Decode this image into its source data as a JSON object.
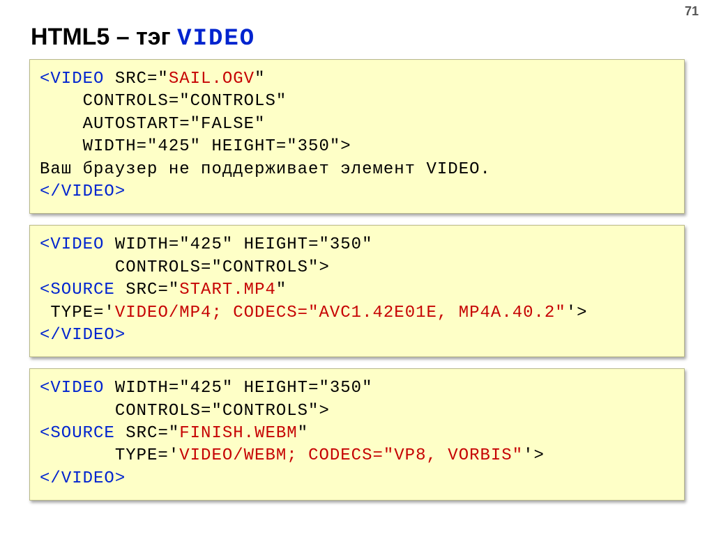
{
  "page_number": "71",
  "title": {
    "prefix": "HTML5 – тэг ",
    "tag": "VIDEO"
  },
  "code1": {
    "l1a": "<",
    "l1b": "VIDEO",
    "l1c": " SRC=\"",
    "l1d": "SAIL.OGV",
    "l1e": "\"",
    "l2": "    CONTROLS=\"CONTROLS\"",
    "l3": "    AUTOSTART=\"FALSE\"",
    "l4": "    WIDTH=\"425\" HEIGHT=\"350\">",
    "l5": "Ваш браузер не поддерживает элемент VIDEO.",
    "l6a": "</",
    "l6b": "VIDEO",
    "l6c": ">"
  },
  "code2": {
    "l1a": "<",
    "l1b": "VIDEO",
    "l1c": " WIDTH=\"425\" HEIGHT=\"350\"",
    "l2": "       CONTROLS=\"CONTROLS\">",
    "l3a": "<",
    "l3b": "SOURCE",
    "l3c": " SRC=\"",
    "l3d": "START.MP4",
    "l3e": "\"",
    "l4a": " TYPE='",
    "l4b": "VIDEO/MP4; CODECS=\"AVC1.42E01E, MP4A.40.2\"",
    "l4c": "'>",
    "l5a": "</",
    "l5b": "VIDEO",
    "l5c": ">"
  },
  "code3": {
    "l1a": "<",
    "l1b": "VIDEO",
    "l1c": " WIDTH=\"425\" HEIGHT=\"350\"",
    "l2": "       CONTROLS=\"CONTROLS\">",
    "l3a": "<",
    "l3b": "SOURCE",
    "l3c": " SRC=\"",
    "l3d": "FINISH.WEBM",
    "l3e": "\"",
    "l4a": "       TYPE='",
    "l4b": "VIDEO/WEBM; CODECS=\"VP8, VORBIS\"",
    "l4c": "'>",
    "l5a": "</",
    "l5b": "VIDEO",
    "l5c": ">"
  }
}
